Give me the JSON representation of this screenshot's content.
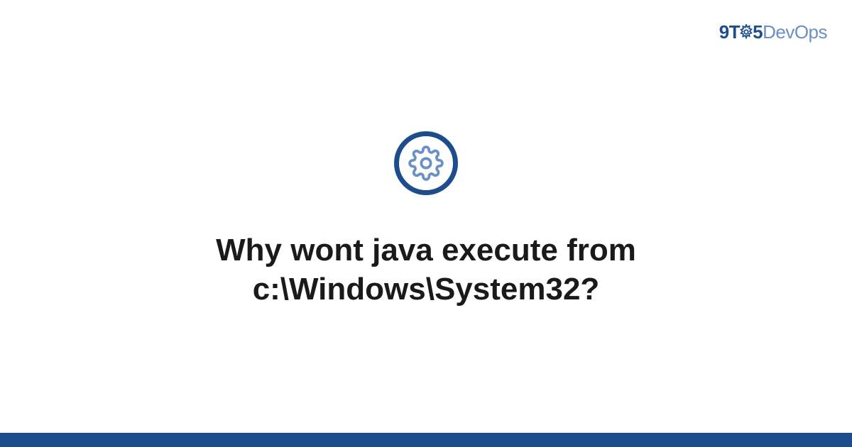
{
  "brand": {
    "prefix": "9T",
    "middle": "5",
    "suffix": "DevOps"
  },
  "icon": {
    "name": "gear-icon"
  },
  "title": "Why wont java execute from c:\\Windows\\System32?",
  "colors": {
    "primary": "#1e4d8b",
    "secondary": "#6b8fc7",
    "text": "#1a1a1a"
  }
}
